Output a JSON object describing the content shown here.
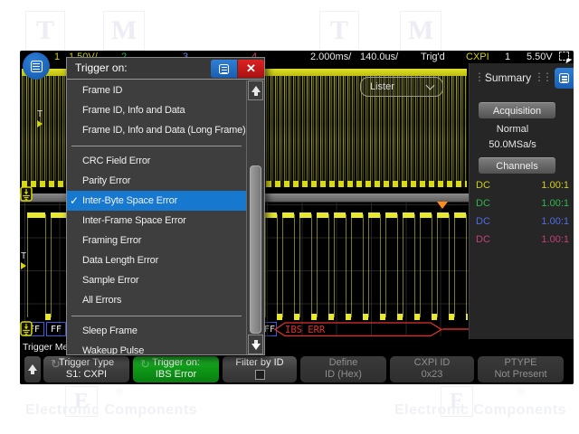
{
  "watermark": {
    "logo_t": "T",
    "logo_m": "M",
    "logo_e": "E",
    "tagline_left": "Electronic Components",
    "tagline_right": "Electronic Components",
    "reg": "®"
  },
  "topbar": {
    "ch1_num": "1",
    "ch1_scale": "1.50V/",
    "ch2_num": "2",
    "ch3_num": "3",
    "ch4_num": "4",
    "timebase": "2.000ms/",
    "delay": "140.0us/",
    "trig_status": "Trig'd",
    "serial_label": "CXPI",
    "trig_source": "1",
    "trig_level": "5.50V"
  },
  "lister": {
    "label": "Lister"
  },
  "markers": {
    "trigger_level": "T"
  },
  "menu": {
    "title": "Trigger on:",
    "close": "✕",
    "check": "✓",
    "items": [
      {
        "label": "Frame ID"
      },
      {
        "label": "Frame ID, Info and Data"
      },
      {
        "label": "Frame ID, Info and Data (Long Frame)"
      },
      {
        "label": "CRC Field Error"
      },
      {
        "label": "Parity Error"
      },
      {
        "label": "Inter-Byte Space Error",
        "selected": true
      },
      {
        "label": "Inter-Frame Space Error"
      },
      {
        "label": "Framing Error"
      },
      {
        "label": "Data Length Error"
      },
      {
        "label": "Sample Error"
      },
      {
        "label": "All Errors"
      },
      {
        "label": "Sleep Frame"
      },
      {
        "label": "Wakeup Pulse"
      }
    ]
  },
  "summary_panel": {
    "title": "Summary",
    "acquisition_label": "Acquisition",
    "acq_mode": "Normal",
    "sample_rate": "50.0MSa/s",
    "channels_label": "Channels",
    "channels": [
      {
        "coupling": "DC",
        "probe": "1.00:1",
        "color": "#cfcf20"
      },
      {
        "coupling": "DC",
        "probe": "1.00:1",
        "color": "#2db84d"
      },
      {
        "coupling": "DC",
        "probe": "1.00:1",
        "color": "#4d6de6"
      },
      {
        "coupling": "DC",
        "probe": "1.00:1",
        "color": "#c2407a"
      }
    ]
  },
  "decode": {
    "byte1": "FF",
    "byte2": "FF",
    "partial_byte": "FF",
    "error_label": "IBS ERR"
  },
  "softkeys": {
    "menu_label": "Trigger Menu",
    "keys": [
      {
        "line1": "Trigger Type",
        "line2": "S1: CXPI"
      },
      {
        "line1": "Trigger on:",
        "line2": "IBS Error"
      },
      {
        "line1": "Filter by ID",
        "line2": ""
      },
      {
        "line1": "Define",
        "line2": "ID (Hex)"
      },
      {
        "line1": "CXPI ID",
        "line2": "0x23"
      },
      {
        "line1": "PTYPE",
        "line2": "Not Present"
      }
    ]
  }
}
